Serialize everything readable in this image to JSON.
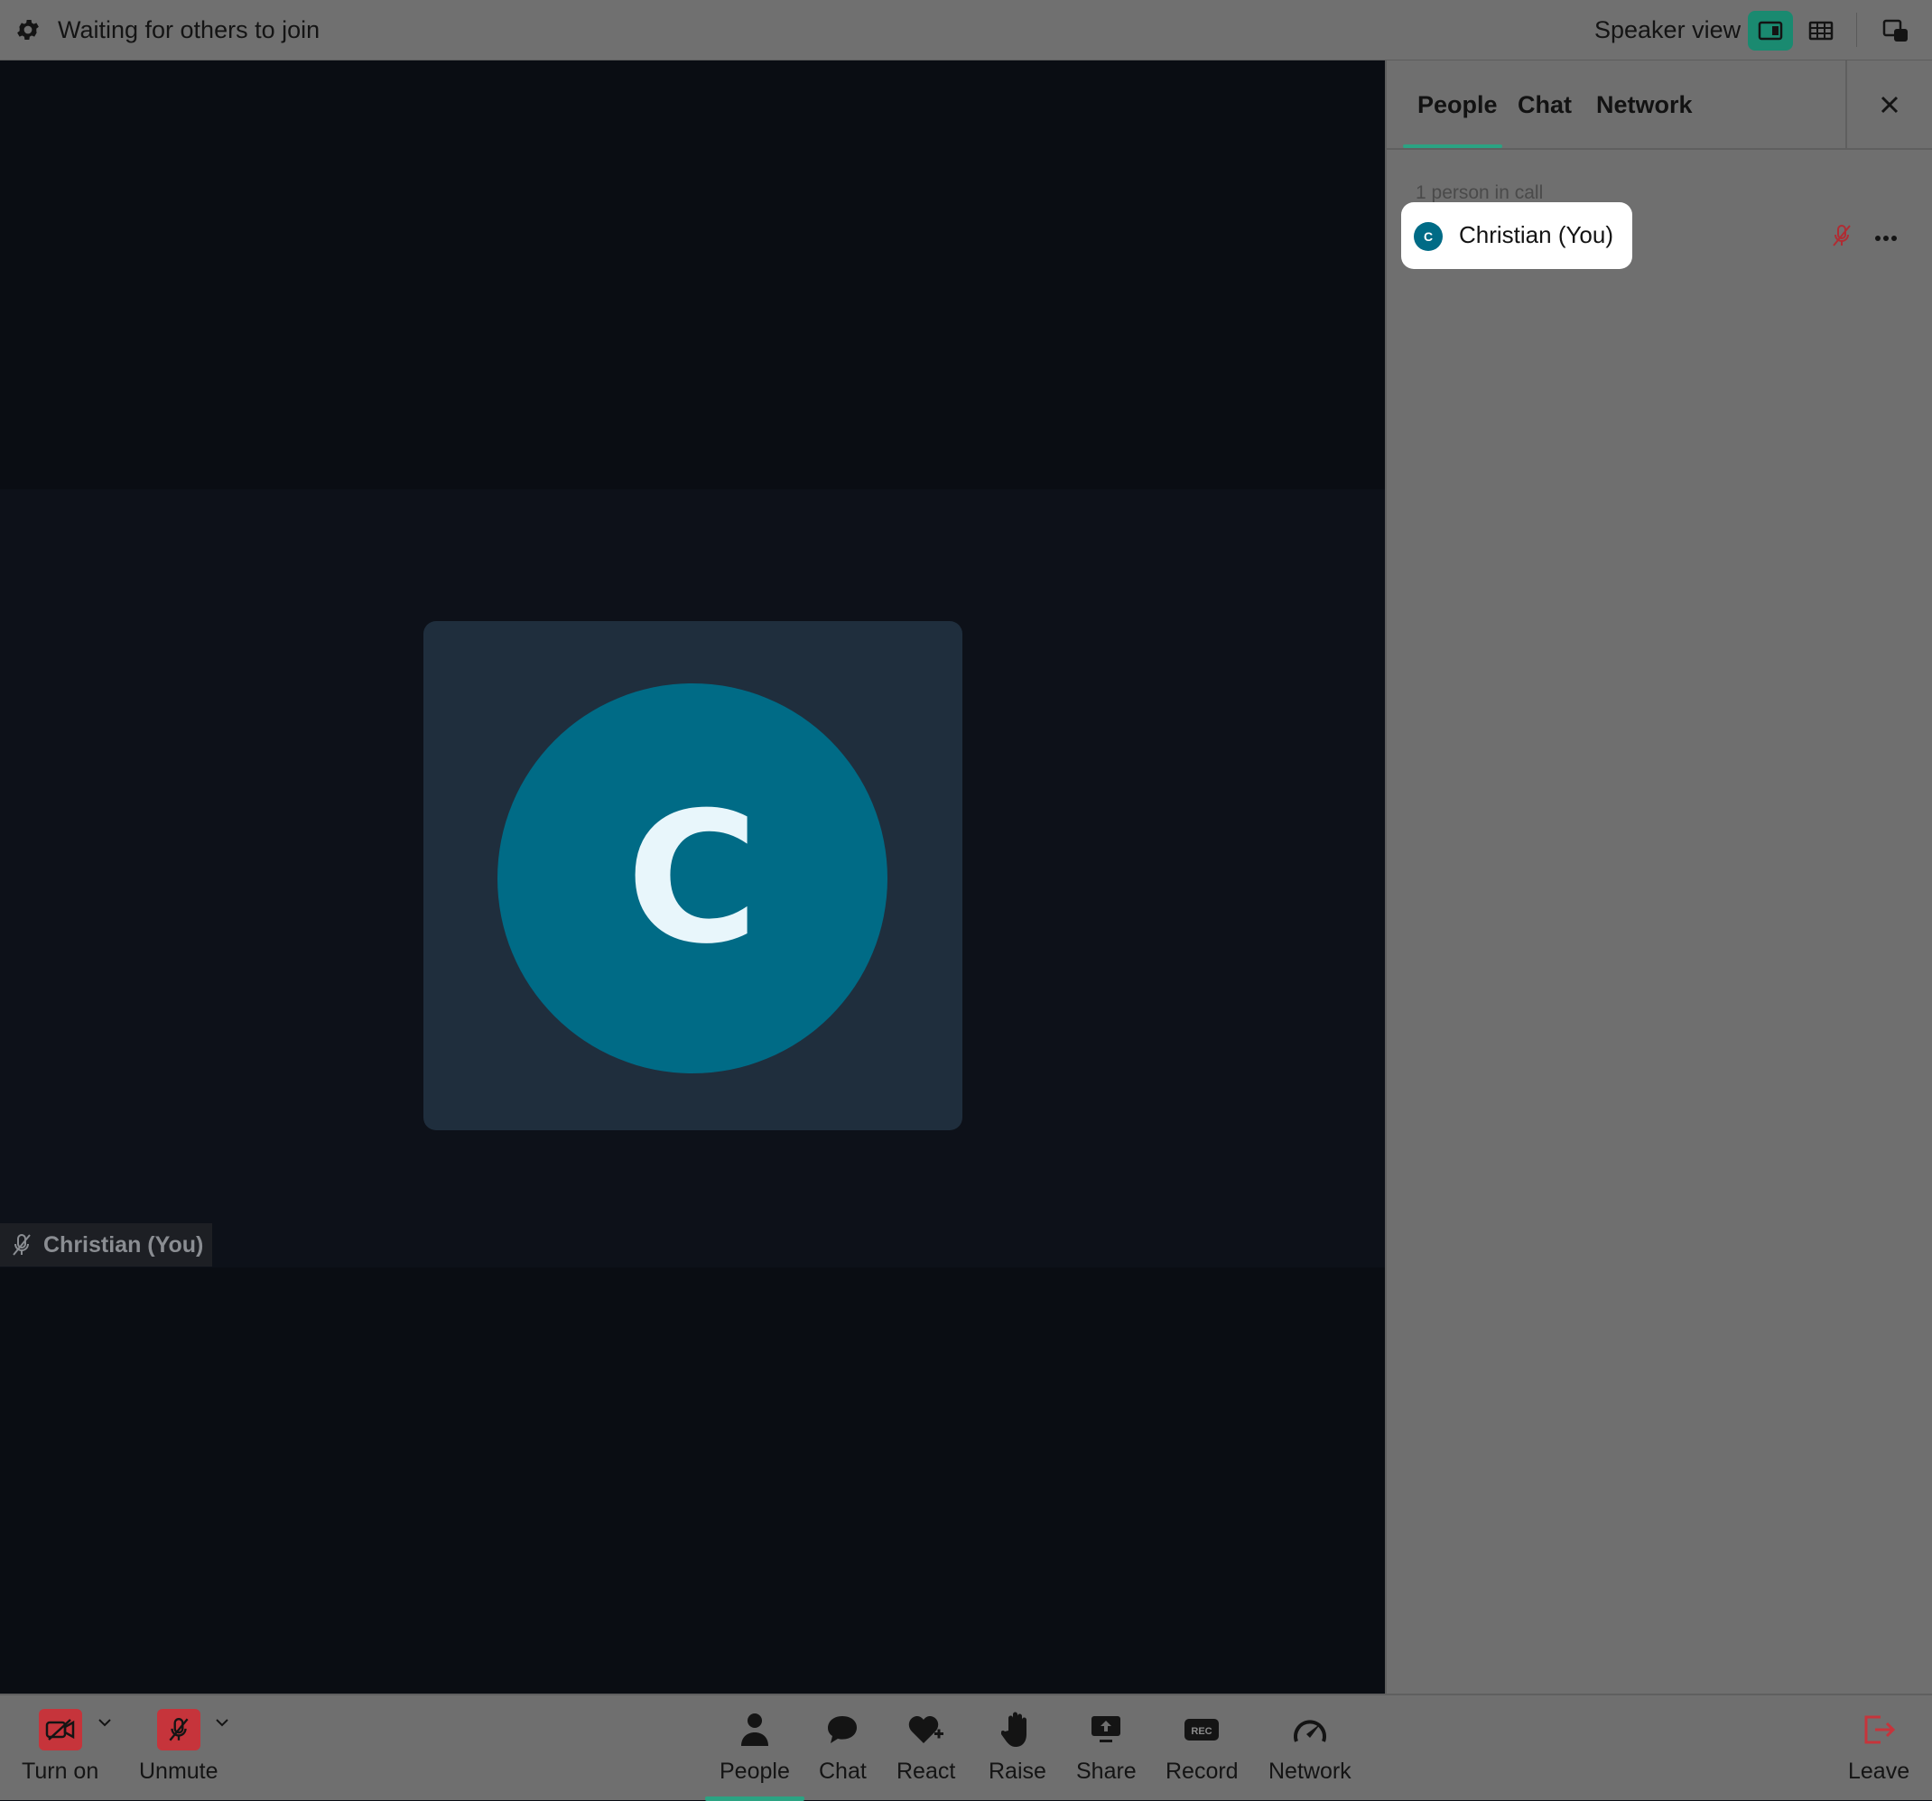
{
  "topbar": {
    "status": "Waiting for others to join",
    "view_label": "Speaker view",
    "accent": "#1a8a70"
  },
  "video": {
    "avatar_initial": "C",
    "avatar_color": "#006b86",
    "participant_label": "Christian (You)"
  },
  "panel": {
    "tabs": [
      {
        "label": "People",
        "active": true
      },
      {
        "label": "Chat",
        "active": false
      },
      {
        "label": "Network",
        "active": false
      }
    ],
    "count_text": "1 person in call",
    "participants": [
      {
        "initial": "C",
        "name": "Christian (You)",
        "muted": true
      }
    ]
  },
  "toolbar": {
    "camera_label": "Turn on",
    "mic_label": "Unmute",
    "items": [
      {
        "label": "People",
        "icon": "person-icon",
        "active": true
      },
      {
        "label": "Chat",
        "icon": "chat-bubble-icon"
      },
      {
        "label": "React",
        "icon": "heart-plus-icon"
      },
      {
        "label": "Raise",
        "icon": "hand-icon"
      },
      {
        "label": "Share",
        "icon": "share-screen-icon"
      },
      {
        "label": "Record",
        "icon": "rec-icon"
      },
      {
        "label": "Network",
        "icon": "gauge-icon"
      }
    ],
    "leave_label": "Leave",
    "danger_color": "#c6343b"
  }
}
